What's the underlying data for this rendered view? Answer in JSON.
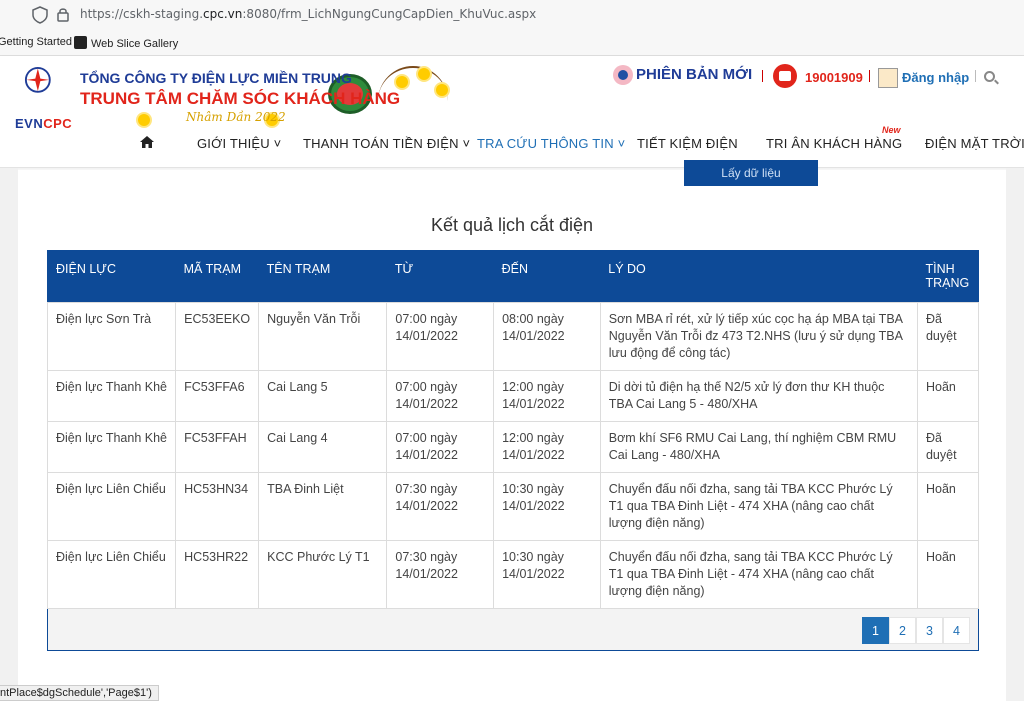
{
  "browser": {
    "url_prefix": "https://cskh-staging.",
    "url_domain": "cpc.vn",
    "url_suffix": ":8080/frm_LichNgungCungCapDien_KhuVuc.aspx",
    "bookmarks": [
      "Getting Started",
      "Web Slice Gallery"
    ],
    "status_text": "ntPlace$dgSchedule','Page$1')"
  },
  "header": {
    "logo_text_a": "EVN",
    "logo_text_b": "CPC",
    "banner_line1": "TỔNG CÔNG TY ĐIỆN LỰC MIỀN TRUNG",
    "banner_line2": "TRUNG TÂM CHĂM SÓC KHÁCH HÀNG",
    "banner_line3": "Nhâm Dần 2022",
    "new_version": "PHIÊN BẢN MỚI",
    "hotline": "19001909",
    "login": "Đăng nhập",
    "new_tag": "New"
  },
  "nav": {
    "items": [
      "GIỚI THIỆU ˅",
      "THANH TOÁN TIỀN ĐIỆN ˅",
      "TRA CỨU THÔNG TIN ˅",
      "TIẾT KIỆM ĐIỆN",
      "TRI ÂN KHÁCH HÀNG",
      "ĐIỆN MẶT TRỜI ˅"
    ]
  },
  "fetch_button": "Lấy dữ liệu",
  "result_title": "Kết quả lịch cắt điện",
  "table": {
    "headers": [
      "ĐIỆN LỰC",
      "MÃ TRẠM",
      "TÊN TRẠM",
      "TỪ",
      "ĐẾN",
      "LÝ DO",
      "TÌNH TRẠNG"
    ],
    "rows": [
      [
        "Điện lực Sơn Trà",
        "EC53EEKO",
        "Nguyễn Văn Trỗi",
        "07:00 ngày 14/01/2022",
        "08:00 ngày 14/01/2022",
        "Sơn MBA rỉ rét, xử lý tiếp xúc cọc hạ áp MBA tại TBA Nguyễn Văn Trỗi đz 473 T2.NHS (lưu ý sử dụng TBA lưu động để công tác)",
        "Đã duyệt"
      ],
      [
        "Điện lực Thanh Khê",
        "FC53FFA6",
        "Cai Lang 5",
        "07:00 ngày 14/01/2022",
        "12:00 ngày 14/01/2022",
        "Di dời tủ điện hạ thế N2/5 xử lý đơn thư KH thuộc TBA Cai Lang 5 - 480/XHA",
        "Hoãn"
      ],
      [
        "Điện lực Thanh Khê",
        "FC53FFAH",
        "Cai Lang 4",
        "07:00 ngày 14/01/2022",
        "12:00 ngày 14/01/2022",
        "Bơm khí SF6 RMU Cai Lang, thí nghiệm CBM RMU Cai Lang - 480/XHA",
        "Đã duyệt"
      ],
      [
        "Điện lực Liên Chiểu",
        "HC53HN34",
        "TBA Đinh Liệt",
        "07:30 ngày 14/01/2022",
        "10:30 ngày 14/01/2022",
        "Chuyển đấu nối đzha, sang tải TBA KCC Phước Lý T1 qua TBA Đinh Liệt - 474 XHA (nâng cao chất lượng điện năng)",
        "Hoãn"
      ],
      [
        "Điện lực Liên Chiểu",
        "HC53HR22",
        "KCC Phước Lý T1",
        "07:30 ngày 14/01/2022",
        "10:30 ngày 14/01/2022",
        "Chuyển đấu nối đzha, sang tải TBA KCC Phước Lý T1 qua TBA Đinh Liệt - 474 XHA (nâng cao chất lượng điện năng)",
        "Hoãn"
      ]
    ]
  },
  "pager": {
    "pages": [
      "1",
      "2",
      "3",
      "4"
    ],
    "current": "1"
  },
  "colors": {
    "primary": "#0d4a97",
    "accent": "#e1251b",
    "link": "#1f6fb5"
  }
}
